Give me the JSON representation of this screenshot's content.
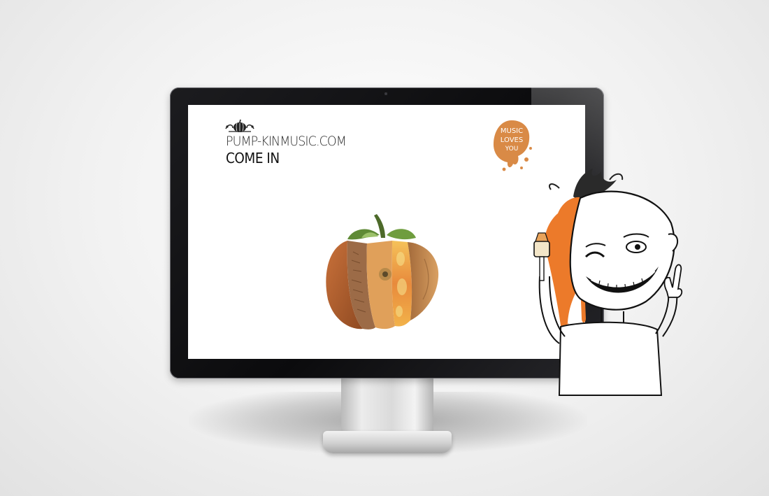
{
  "site": {
    "title": "PUMP-KINMUSIC.COM",
    "enter_link": "COME IN",
    "badge_text": [
      "MUSIC",
      "LOVES",
      "YOU"
    ]
  },
  "icons": {
    "logo": "pumpkin-ornament-icon",
    "main_art": "pumpkin-collage-image",
    "character": "grinning-character-illustration"
  },
  "colors": {
    "accent_orange": "#e8752a",
    "badge_orange": "#d98a46",
    "text_dark": "#222222"
  }
}
